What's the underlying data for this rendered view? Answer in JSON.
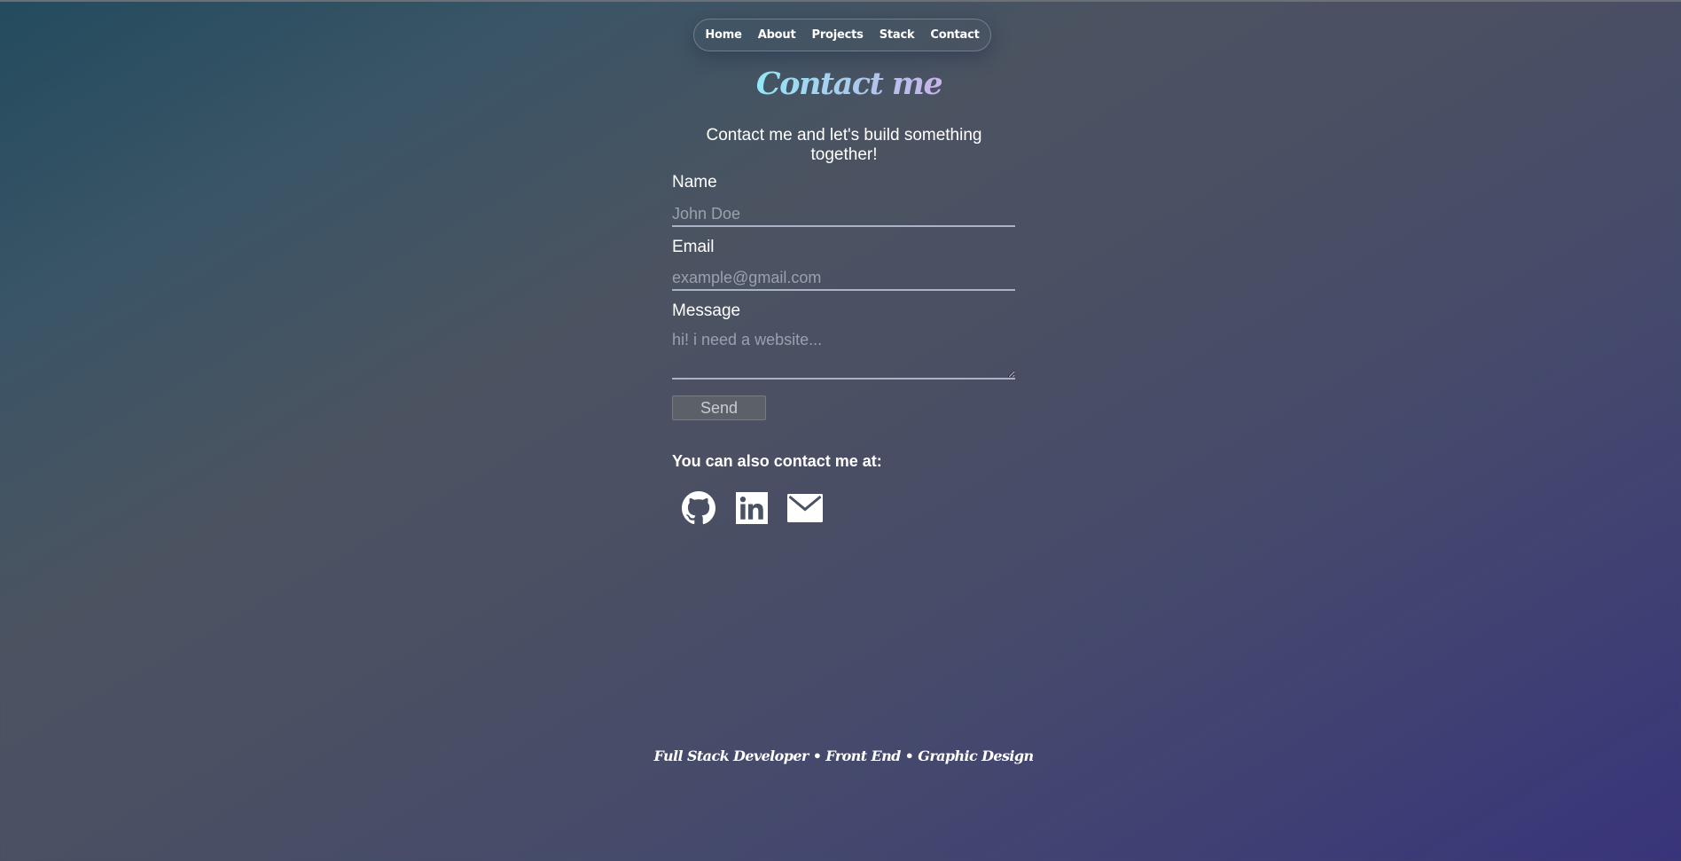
{
  "nav": {
    "items": [
      {
        "label": "Home"
      },
      {
        "label": "About"
      },
      {
        "label": "Projects"
      },
      {
        "label": "Stack"
      },
      {
        "label": "Contact"
      }
    ]
  },
  "page": {
    "title": "Contact me",
    "subtitle": "Contact me and let's build something together!"
  },
  "form": {
    "name": {
      "label": "Name",
      "placeholder": "John Doe",
      "value": ""
    },
    "email": {
      "label": "Email",
      "placeholder": "example@gmail.com",
      "value": ""
    },
    "message": {
      "label": "Message",
      "placeholder": "hi! i need a website...",
      "value": ""
    },
    "send_label": "Send"
  },
  "contact": {
    "heading": "You can also contact me at:",
    "icons": [
      "github-icon",
      "linkedin-icon",
      "mail-icon"
    ]
  },
  "footer": {
    "text": "Full Stack Developer • Front End • Graphic Design"
  },
  "colors": {
    "title_gradient_start": "#93e6f6",
    "title_gradient_end": "#c8b3ea",
    "background_start": "#234b5e",
    "background_end": "#38347a"
  }
}
